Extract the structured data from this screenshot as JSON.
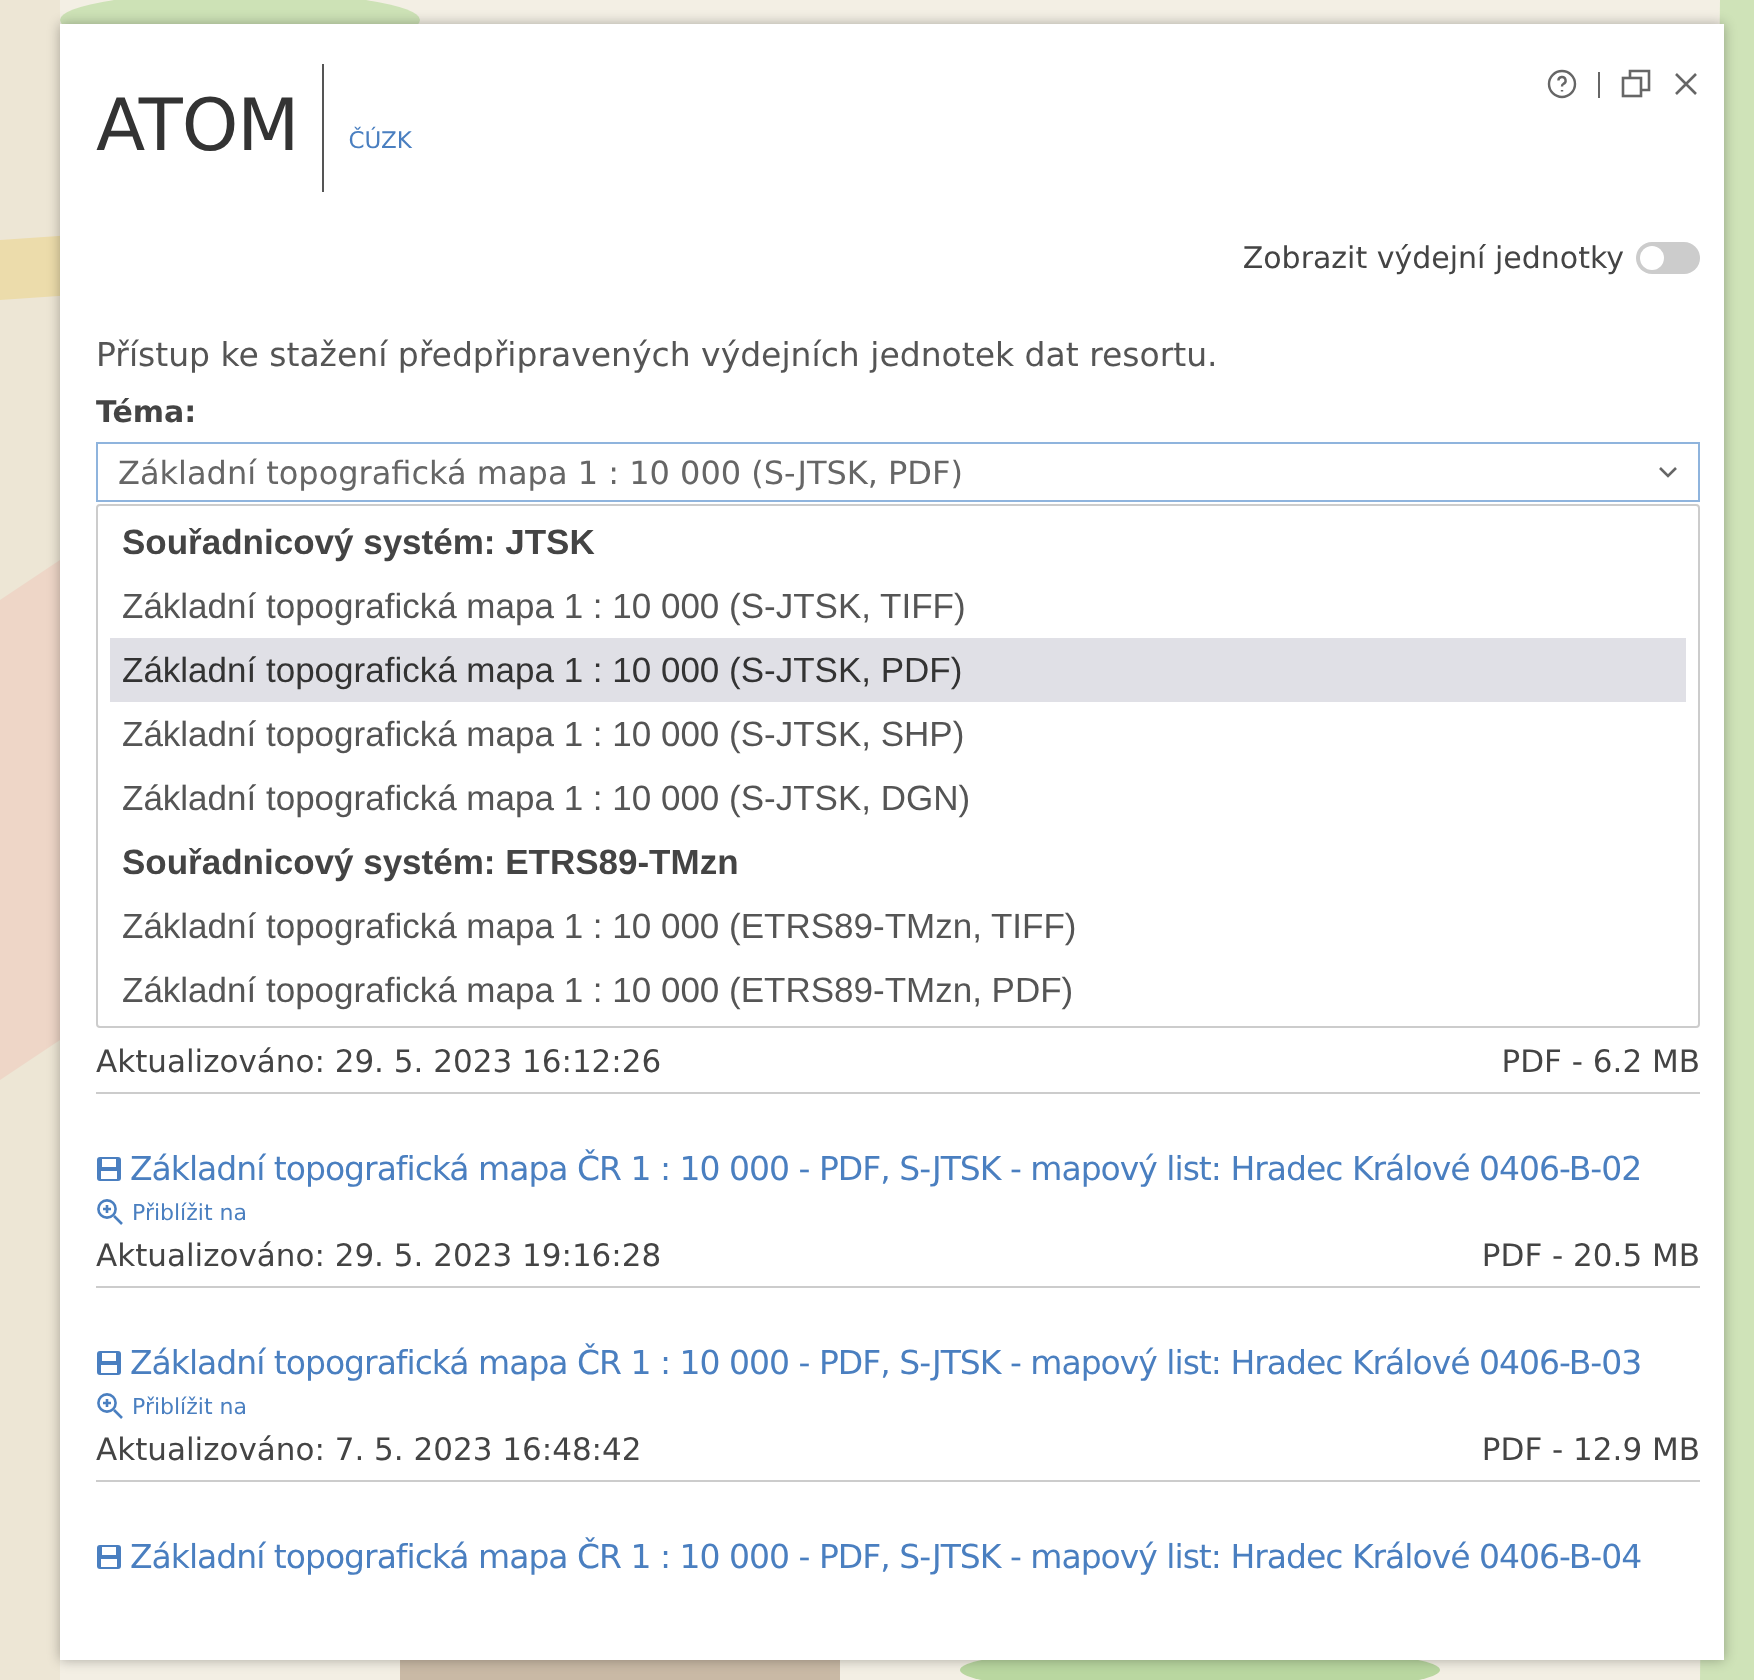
{
  "header": {
    "logo": "ATOM",
    "subtitle": "ČÚZK",
    "toggle": {
      "label": "Zobrazit výdejní jednotky",
      "on": false
    }
  },
  "description": "Přístup ke stažení předpřipravených výdejních jednotek dat resortu.",
  "theme": {
    "label": "Téma:",
    "value": "Základní topografická mapa 1 : 10 000 (S-JTSK, PDF)",
    "options": [
      {
        "kind": "group",
        "label": "Souřadnicový systém: JTSK"
      },
      {
        "kind": "option",
        "label": "Základní topografická mapa 1 : 10 000 (S-JTSK, TIFF)",
        "selected": false
      },
      {
        "kind": "option",
        "label": "Základní topografická mapa 1 : 10 000 (S-JTSK, PDF)",
        "selected": true
      },
      {
        "kind": "option",
        "label": "Základní topografická mapa 1 : 10 000 (S-JTSK, SHP)",
        "selected": false
      },
      {
        "kind": "option",
        "label": "Základní topografická mapa 1 : 10 000 (S-JTSK, DGN)",
        "selected": false
      },
      {
        "kind": "group",
        "label": "Souřadnicový systém: ETRS89-TMzn"
      },
      {
        "kind": "option",
        "label": "Základní topografická mapa 1 : 10 000 (ETRS89-TMzn, TIFF)",
        "selected": false
      },
      {
        "kind": "option",
        "label": "Základní topografická mapa 1 : 10 000 (ETRS89-TMzn, PDF)",
        "selected": false
      }
    ]
  },
  "results": [
    {
      "updated": "Aktualizováno: 29. 5. 2023 16:12:26",
      "size": "PDF - 6.2 MB"
    },
    {
      "title": "Základní topografická mapa ČR 1 : 10 000 - PDF, S-JTSK - mapový list: Hradec Králové 0406-B-02",
      "zoom": "Přiblížit na",
      "updated": "Aktualizováno: 29. 5. 2023 19:16:28",
      "size": "PDF - 20.5 MB"
    },
    {
      "title": "Základní topografická mapa ČR 1 : 10 000 - PDF, S-JTSK - mapový list: Hradec Králové 0406-B-03",
      "zoom": "Přiblížit na",
      "updated": "Aktualizováno: 7. 5. 2023 16:48:42",
      "size": "PDF - 12.9 MB"
    },
    {
      "title": "Základní topografická mapa ČR 1 : 10 000 - PDF, S-JTSK - mapový list: Hradec Králové 0406-B-04"
    }
  ]
}
